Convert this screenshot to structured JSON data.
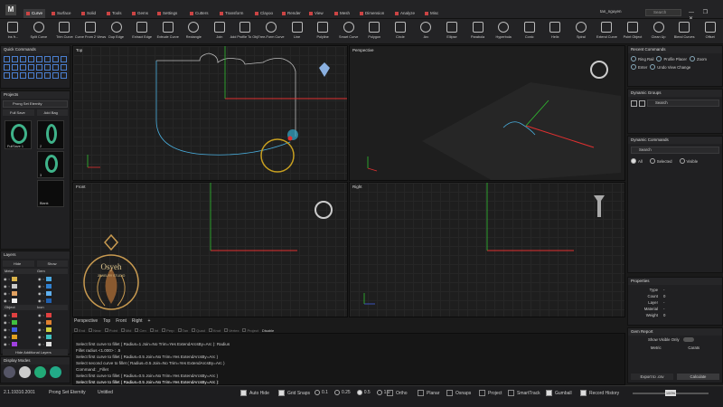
{
  "menu": {
    "logo": "M",
    "tabs": [
      "Curve",
      "Surface",
      "Solid",
      "Tools",
      "Gems",
      "Settings",
      "Cutters",
      "Transform",
      "Clayoo",
      "Render",
      "View",
      "Mesh",
      "Dimension",
      "Analyze",
      "Misc"
    ],
    "active": "Curve",
    "user": "tan_nguyen",
    "search_placeholder": "Search",
    "window_controls": "— ❐ ✕"
  },
  "toolbar": {
    "tools": [
      "Ins fr...",
      "Split Curve",
      "Trim Curve",
      "Curve From 2 Views",
      "Dup Edge",
      "Extract Edge",
      "Extrude Curve",
      "Rectangle",
      "Join",
      "Add Profile To Obj...",
      "Free-Form Curve",
      "Line",
      "Polyline",
      "Smart Curve",
      "Polygon",
      "Circle",
      "Arc",
      "Ellipse",
      "Parabola",
      "Hyperbola",
      "Conic",
      "Helix",
      "Spiral",
      "Extend Curve",
      "Point Object",
      "Clean Up",
      "Blend Curves",
      "Offset"
    ]
  },
  "quick_commands": {
    "title": "Quick Commands"
  },
  "projects": {
    "title": "Projects",
    "dropdown": "Prong Set Eternity",
    "full_save": "Full Save",
    "add_bag": "Add Bag",
    "thumbs": [
      "FullSave 1",
      "2",
      "3",
      "Blank"
    ]
  },
  "layers": {
    "title": "Layers",
    "hide": "Hide",
    "show": "Show",
    "group_metal": "Metal",
    "group_gem": "Gem",
    "group_object": "Object",
    "group_icon": "Icon",
    "hide_additional": "Hide Additional Layers",
    "metal_colors": [
      "#d9b24a",
      "#c9c9c9",
      "#e0a060",
      "#f0f0f0"
    ],
    "gem_colors": [
      "#4aa8e0",
      "#3080d0",
      "#5fb0f0",
      "#2060b0"
    ],
    "object_colors": [
      "#e04040",
      "#40c040",
      "#4060e0",
      "#e0a020",
      "#a040e0"
    ],
    "icon_colors": [
      "#e04040",
      "#e08030",
      "#d0d040",
      "#40c0c0",
      "#e0e0e0"
    ]
  },
  "display_modes": {
    "title": "Display Modes"
  },
  "viewports": {
    "top": "Top",
    "perspective": "Perspective",
    "front": "Front",
    "right": "Right",
    "bottom_tabs": [
      "Perspective",
      "Top",
      "Front",
      "Right"
    ]
  },
  "osnap_row": {
    "items": [
      "End",
      "Near",
      "Point",
      "Mid",
      "Cen",
      "Int",
      "Perp",
      "Tan",
      "Quad",
      "Knot",
      "Vertex",
      "Project"
    ],
    "disable": "Disable"
  },
  "command_history": [
    "Select first curve to fillet ( Radius=1  Join=No  Trim=Yes  ExtendArcsBy=Arc ): Radius",
    "Fillet radius <1.000> : .5",
    "Select first curve to fillet ( Radius=0.5  Join=No  Trim=Yes  ExtendArcsBy=Arc )",
    "Select second curve to fillet ( Radius=0.5  Join=No  Trim=Yes  ExtendArcsBy=Arc )",
    "Command: _Fillet",
    "Select first curve to fillet ( Radius=0.5  Join=No  Trim=Yes  ExtendArcsBy=Arc )",
    "Select first curve to fillet ( Radius=0.5  Join=No  Trim=Yes  ExtendArcsBy=Arc ):"
  ],
  "recent_commands": {
    "title": "Recent Commands",
    "items": [
      "Ring Rail",
      "Profile Placer",
      "Zoom",
      "Enter",
      "Undo View Change"
    ]
  },
  "dynamic_groups": {
    "title": "Dynamic Groups",
    "search": "Search"
  },
  "dynamic_commands": {
    "title": "Dynamic Commands",
    "search": "Search",
    "filters": [
      "All",
      "Selected",
      "Visible"
    ],
    "selected_filter": "All"
  },
  "properties": {
    "title": "Properties",
    "rows": [
      {
        "k": "Type",
        "v": "-"
      },
      {
        "k": "Count",
        "v": "0"
      },
      {
        "k": "Layer",
        "v": "-"
      },
      {
        "k": "Material",
        "v": "-"
      },
      {
        "k": "Weight",
        "v": "0"
      }
    ]
  },
  "gem_report": {
    "title": "Gem Report",
    "show_visible_only": "Show Visible Only",
    "cols": [
      "Metric",
      "Carats"
    ],
    "export": "Export to .csv",
    "calculate": "Calculate"
  },
  "watermark": {
    "brand": "Osyeh",
    "sub": "JEWELRY STUDIO"
  },
  "statusbar": {
    "version": "2.1.19310.2001",
    "project": "Prong Set Eternity",
    "doc": "Untitled",
    "auto_hide": "Auto Hide",
    "grid_snaps": "Grid Snaps",
    "snap_values": [
      "0.1",
      "0.25",
      "0.5",
      "1.0"
    ],
    "snap_selected": "0.5",
    "ortho": "Ortho",
    "planar": "Planar",
    "osnaps": "Osnaps",
    "project_lbl": "Project",
    "smarttrack": "SmartTrack",
    "gumball": "Gumball",
    "record_history": "Record History",
    "zoom": "100%"
  },
  "colors": {
    "accent": "#4a7fd0",
    "axis_red": "#e03030",
    "axis_green": "#30c030",
    "curve": "#4ab0e0"
  }
}
